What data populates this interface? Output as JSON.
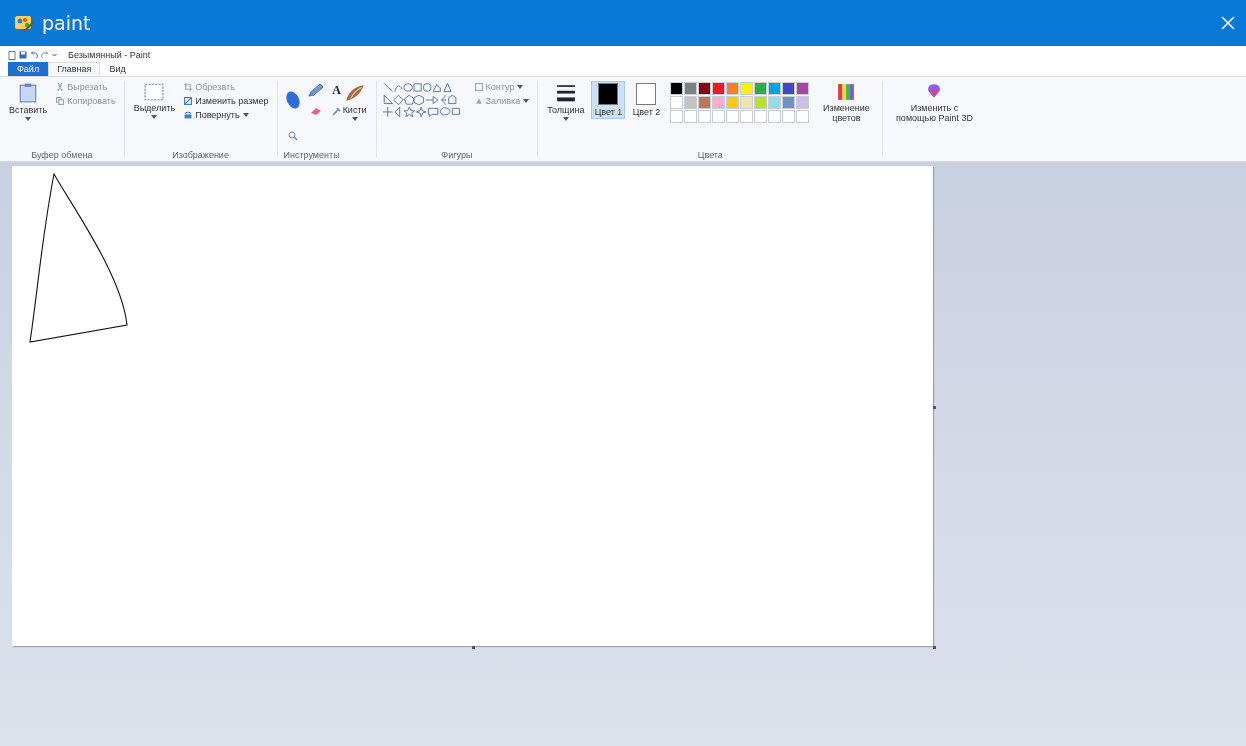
{
  "window": {
    "title": "paint"
  },
  "quick_access": {
    "document_title": "Безымянный - Paint"
  },
  "tabs": [
    {
      "label": "Файл",
      "kind": "file",
      "selected": false
    },
    {
      "label": "Главная",
      "kind": "tab",
      "selected": true
    },
    {
      "label": "Вид",
      "kind": "tab",
      "selected": false
    }
  ],
  "ribbon": {
    "clipboard": {
      "label": "Буфер обмена",
      "paste": "Вставить",
      "cut": {
        "label": "Вырезать",
        "disabled": true
      },
      "copy": {
        "label": "Копировать",
        "disabled": true
      }
    },
    "image": {
      "label": "Изображение",
      "select": "Выделить",
      "crop": {
        "label": "Обрезать",
        "disabled": true
      },
      "resize": {
        "label": "Изменить размер",
        "disabled": false
      },
      "rotate": {
        "label": "Повернуть",
        "disabled": false
      }
    },
    "tools": {
      "label": "Инструменты",
      "text_tool": "A"
    },
    "brushes": {
      "label": "Кисти"
    },
    "shapes": {
      "label": "Фигуры",
      "outline": {
        "label": "Контур",
        "disabled": true
      },
      "fill": {
        "label": "Заливка",
        "disabled": true
      }
    },
    "size": {
      "label": "Толщина"
    },
    "colors": {
      "label": "Цвета",
      "color1": {
        "label": "Цвет 1",
        "selected": true,
        "color": "#000000"
      },
      "color2": {
        "label": "Цвет 2",
        "selected": false,
        "color": "#ffffff"
      },
      "palette": [
        {
          "color": "#000000"
        },
        {
          "color": "#7f7f7f"
        },
        {
          "color": "#880015"
        },
        {
          "color": "#ed1c24"
        },
        {
          "color": "#ff7f27"
        },
        {
          "color": "#fff200"
        },
        {
          "color": "#22b14c"
        },
        {
          "color": "#00a2e8"
        },
        {
          "color": "#3f48cc"
        },
        {
          "color": "#a349a4"
        },
        {
          "color": "#ffffff"
        },
        {
          "color": "#c3c3c3"
        },
        {
          "color": "#b97a57"
        },
        {
          "color": "#ffaec9"
        },
        {
          "color": "#ffc90e"
        },
        {
          "color": "#efe4b0"
        },
        {
          "color": "#b5e61d"
        },
        {
          "color": "#99d9ea"
        },
        {
          "color": "#7092be"
        },
        {
          "color": "#c8bfe7"
        }
      ],
      "edit": "Изменение цветов"
    },
    "paint3d": "Изменить с помощью Paint 3D"
  }
}
